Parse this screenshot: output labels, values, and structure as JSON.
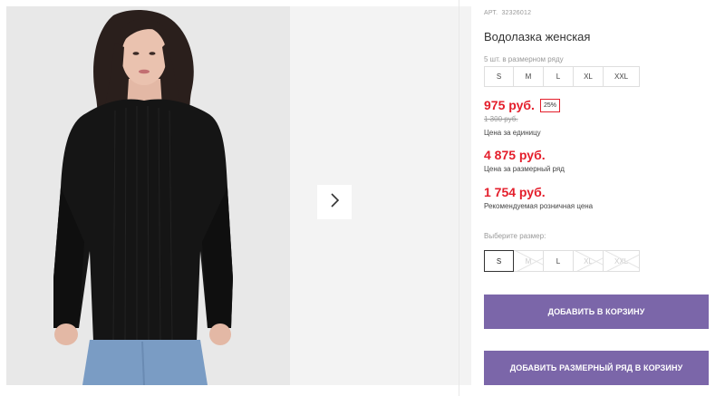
{
  "product": {
    "sku_label": "АРТ.",
    "sku_value": "32326012",
    "title": "Водолазка женская",
    "pack_note": "5 шт. в размерном ряду",
    "pack_sizes": [
      "S",
      "M",
      "L",
      "XL",
      "XXL"
    ]
  },
  "pricing": {
    "unit_price": "975 руб.",
    "discount": "25%",
    "old_price": "1 300 руб.",
    "unit_caption": "Цена за единицу",
    "pack_price": "4 875 руб.",
    "pack_caption": "Цена за размерный ряд",
    "retail_price": "1 754 руб.",
    "retail_caption": "Рекомендуемая розничная цена"
  },
  "size_select": {
    "label": "Выберите размер:",
    "options": [
      {
        "label": "S",
        "state": "selected"
      },
      {
        "label": "M",
        "state": "unavailable"
      },
      {
        "label": "L",
        "state": "available"
      },
      {
        "label": "XL",
        "state": "unavailable"
      },
      {
        "label": "XXL",
        "state": "unavailable"
      }
    ]
  },
  "actions": {
    "add_to_cart": "ДОБАВИТЬ В КОРЗИНУ",
    "add_pack_to_cart": "ДОБАВИТЬ РАЗМЕРНЫЙ РЯД В КОРЗИНУ"
  },
  "gallery": {
    "next_icon": "chevron-right-icon"
  },
  "colors": {
    "accent_price": "#e41e2b",
    "button_purple": "#7b66a9"
  }
}
